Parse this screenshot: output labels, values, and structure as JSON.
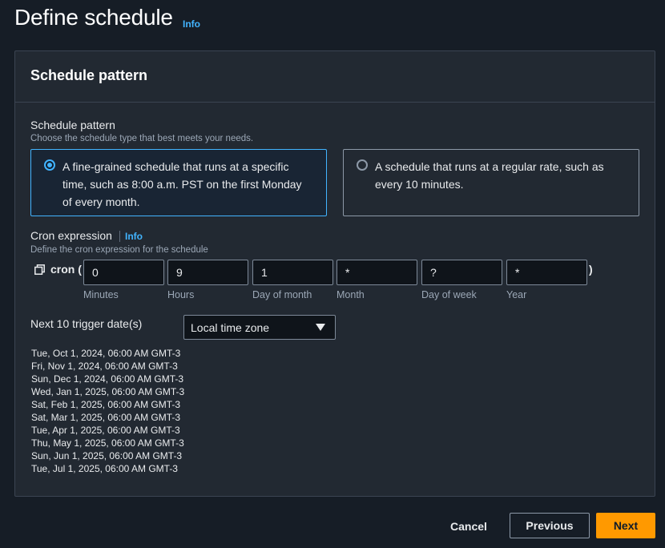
{
  "page": {
    "title": "Define schedule",
    "info": "Info"
  },
  "panel": {
    "title": "Schedule pattern",
    "pattern_label": "Schedule pattern",
    "pattern_desc": "Choose the schedule type that best meets your needs.",
    "options": [
      {
        "label": "A fine-grained schedule that runs at a specific time, such as 8:00 a.m. PST on the first Monday of every month.",
        "selected": true
      },
      {
        "label": "A schedule that runs at a regular rate, such as every 10 minutes.",
        "selected": false
      }
    ],
    "cron": {
      "label": "Cron expression",
      "info": "Info",
      "desc": "Define the cron expression for the schedule",
      "prefix": "cron (",
      "suffix": ")",
      "fields": [
        {
          "value": "0",
          "caption": "Minutes"
        },
        {
          "value": "9",
          "caption": "Hours"
        },
        {
          "value": "1",
          "caption": "Day of month"
        },
        {
          "value": "*",
          "caption": "Month"
        },
        {
          "value": "?",
          "caption": "Day of week"
        },
        {
          "value": "*",
          "caption": "Year"
        }
      ]
    },
    "next_dates_label": "Next 10 trigger date(s)",
    "timezone_select": "Local time zone",
    "trigger_dates": [
      "Tue, Oct 1, 2024, 06:00 AM GMT-3",
      "Fri, Nov 1, 2024, 06:00 AM GMT-3",
      "Sun, Dec 1, 2024, 06:00 AM GMT-3",
      "Wed, Jan 1, 2025, 06:00 AM GMT-3",
      "Sat, Feb 1, 2025, 06:00 AM GMT-3",
      "Sat, Mar 1, 2025, 06:00 AM GMT-3",
      "Tue, Apr 1, 2025, 06:00 AM GMT-3",
      "Thu, May 1, 2025, 06:00 AM GMT-3",
      "Sun, Jun 1, 2025, 06:00 AM GMT-3",
      "Tue, Jul 1, 2025, 06:00 AM GMT-3"
    ]
  },
  "footer": {
    "cancel": "Cancel",
    "previous": "Previous",
    "next": "Next"
  },
  "colors": {
    "accent": "#42b4ff",
    "primary_button": "#ff9900",
    "background": "#161d26",
    "panel": "#222932"
  }
}
